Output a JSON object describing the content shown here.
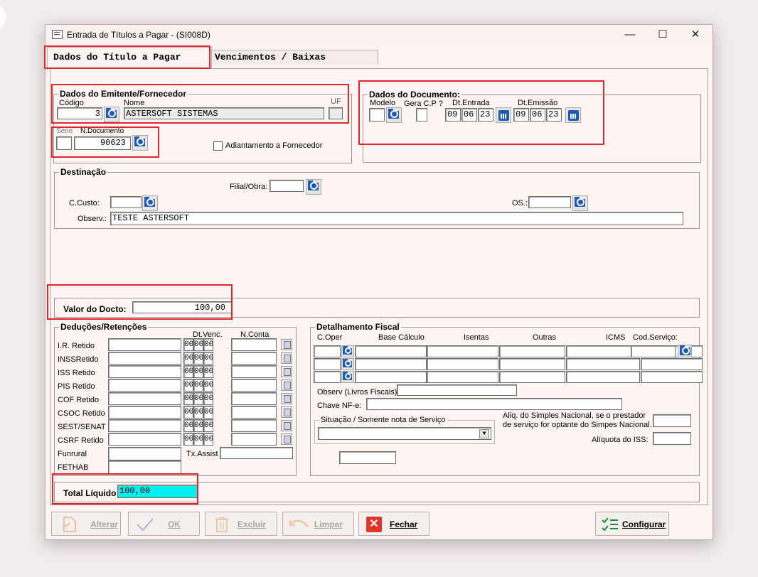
{
  "window": {
    "title": "Entrada de Títulos a Pagar - (SI008D)"
  },
  "tabs": [
    {
      "label": "Dados do Título a Pagar"
    },
    {
      "label": "Vencimentos / Baixas"
    }
  ],
  "emitente": {
    "group_label": "Dados do Emitente/Fornecedor",
    "codigo_label": "Código",
    "codigo_value": "3",
    "nome_label": "Nome",
    "nome_value": "ASTERSOFT SISTEMAS",
    "uf_label": "UF",
    "uf_value": "",
    "serie_label": "Serie",
    "serie_value": "",
    "ndoc_label": "N.Documento",
    "ndoc_value": "90623",
    "adiantamento_label": "Adiantamento a Fornecedor"
  },
  "documento": {
    "group_label": "Dados do Documento:",
    "modelo_label": "Modelo",
    "gera_label": "Gera C.P ?",
    "dt_entrada_label": "Dt.Entrada",
    "dt_entrada": [
      "09",
      "06",
      "23"
    ],
    "dt_emissao_label": "Dt.Emissão",
    "dt_emissao": [
      "09",
      "06",
      "23"
    ]
  },
  "destinacao": {
    "group_label": "Destinação",
    "filial_label": "Filial/Obra:",
    "ccusto_label": "C.Custo:",
    "os_label": "OS.:",
    "observ_label": "Observ.:",
    "observ_value": "TESTE ASTERSOFT"
  },
  "valor": {
    "label": "Valor do Docto:",
    "value": "100,00"
  },
  "deducoes": {
    "group_label": "Deduções/Retenções",
    "dtvenc_label": "Dt.Venc.",
    "nconta_label": "N.Conta",
    "rows": [
      "I.R. Retido",
      "INSSRetido",
      "ISS Retido",
      "PIS Retido",
      "COF Retido",
      "CSOC Retido",
      "SEST/SENAT",
      "CSRF Retido"
    ],
    "date_placeholder": "00",
    "funrural_label": "Funrural",
    "fethab_label": "FETHAB",
    "txassist_label": "Tx.Assist"
  },
  "fiscal": {
    "group_label": "Detalhamento Fiscal",
    "col_coper": "C.Oper",
    "col_base": "Base Cálculo",
    "col_isentas": "Isentas",
    "col_outras": "Outras",
    "col_icms": "ICMS",
    "col_codserv": "Cod.Serviço:",
    "observ_label": "Observ (Livros Fiscais):",
    "chave_label": "Chave NF-e:",
    "situacao_label": "Situação / Somente nota de Serviço",
    "aliq_simples_label1": "Aliq. do Simples Nacional, se o prestador",
    "aliq_simples_label2": "de serviço for optante do Simpes Nacional.",
    "aliq_iss_label": "Alíquota do ISS:"
  },
  "total": {
    "label": "Total Líquido",
    "value": "100,00"
  },
  "buttons": {
    "alterar": "Alterar",
    "ok": "OK",
    "excluir": "Excluir",
    "limpar": "Limpar",
    "fechar": "Fechar",
    "configurar": "Configurar"
  }
}
